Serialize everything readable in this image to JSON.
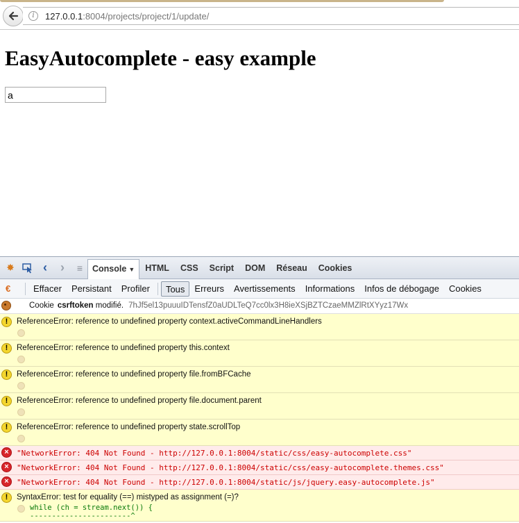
{
  "browser": {
    "url_host": "127.0.0.1",
    "url_rest": ":8004/projects/project/1/update/"
  },
  "page": {
    "title": "EasyAutocomplete - easy example",
    "input_value": "a"
  },
  "firebug": {
    "tabs": [
      {
        "label": "Console",
        "active": true
      },
      {
        "label": "HTML"
      },
      {
        "label": "CSS"
      },
      {
        "label": "Script"
      },
      {
        "label": "DOM"
      },
      {
        "label": "Réseau"
      },
      {
        "label": "Cookies"
      }
    ],
    "filter_left": [
      "Effacer",
      "Persistant",
      "Profiler"
    ],
    "filters": [
      {
        "label": "Tous",
        "active": true
      },
      {
        "label": "Erreurs"
      },
      {
        "label": "Avertissements"
      },
      {
        "label": "Informations"
      },
      {
        "label": "Infos de débogage"
      },
      {
        "label": "Cookies"
      }
    ],
    "cookie_row": {
      "prefix": "Cookie",
      "name": "csrftoken",
      "action": "modifié.",
      "value": "7hJf5el13puuuIDTensfZ0aUDLTeQ7cc0lx3H8ieXSjBZTCzaeMMZlRtXYyz17Wx"
    },
    "warnings": [
      "ReferenceError: reference to undefined property context.activeCommandLineHandlers",
      "ReferenceError: reference to undefined property this.context",
      "ReferenceError: reference to undefined property file.fromBFCache",
      "ReferenceError: reference to undefined property file.document.parent",
      "ReferenceError: reference to undefined property state.scrollTop"
    ],
    "errors": [
      "\"NetworkError: 404 Not Found - http://127.0.0.1:8004/static/css/easy-autocomplete.css\"",
      "\"NetworkError: 404 Not Found - http://127.0.0.1:8004/static/css/easy-autocomplete.themes.css\"",
      "\"NetworkError: 404 Not Found - http://127.0.0.1:8004/static/js/jquery.easy-autocomplete.js\""
    ],
    "syntax_error": {
      "message": "SyntaxError: test for equality (==) mistyped as assignment (=)?",
      "code_line": "while (ch = stream.next()) {",
      "pointer_line": "-----------------------^"
    }
  },
  "icons": {
    "back": "back-arrow-icon",
    "info": "info-icon",
    "warning": "warning-icon",
    "error": "error-icon",
    "cookie": "cookie-icon"
  }
}
